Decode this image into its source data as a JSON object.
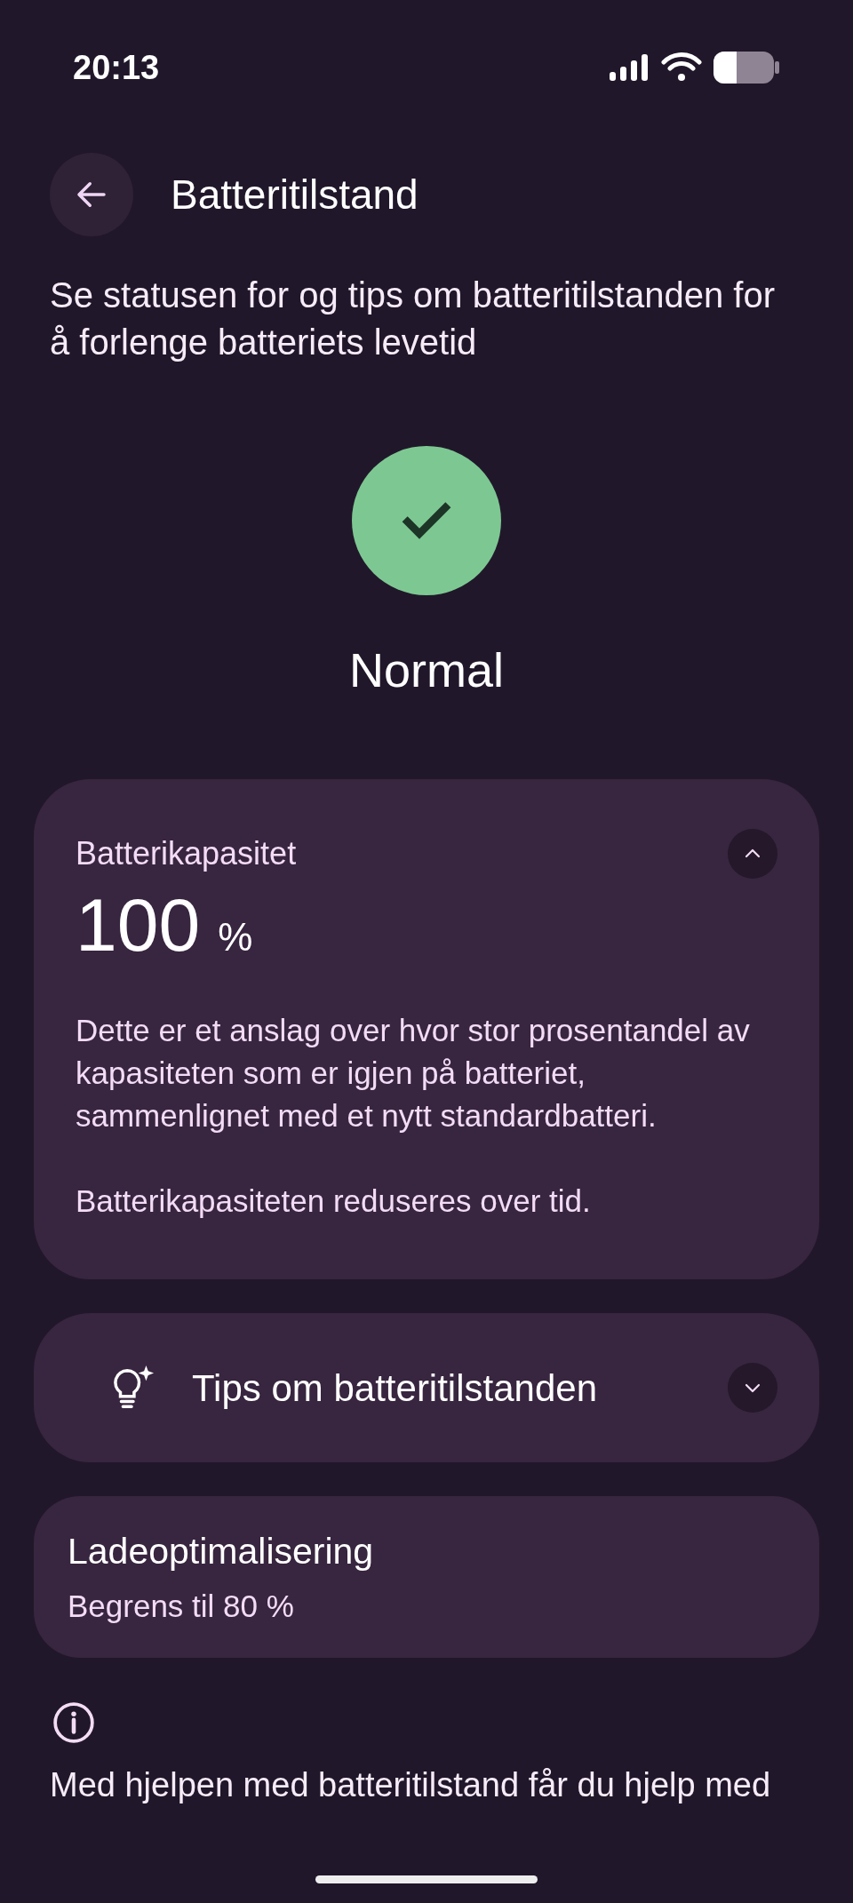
{
  "status_bar": {
    "time": "20:13"
  },
  "header": {
    "title": "Batteritilstand"
  },
  "description": "Se statusen for og tips om batteritilstanden for å forlenge batteriets levetid",
  "status": {
    "kind": "ok",
    "label": "Normal"
  },
  "capacity_card": {
    "title": "Batterikapasitet",
    "expanded": true,
    "value": "100",
    "unit": "%",
    "paragraphs": [
      "Dette er et anslag over hvor stor prosentandel av kapasiteten som er igjen på batteriet, sammenlignet med et nytt standardbatteri.",
      "Batterikapasiteten reduseres over tid."
    ]
  },
  "tips_card": {
    "title": "Tips om batteritilstanden",
    "expanded": false
  },
  "charging_card": {
    "title": "Ladeoptimalisering",
    "subtitle": "Begrens til 80 %"
  },
  "footer_text": "Med hjelpen med batteritilstand får du hjelp med"
}
